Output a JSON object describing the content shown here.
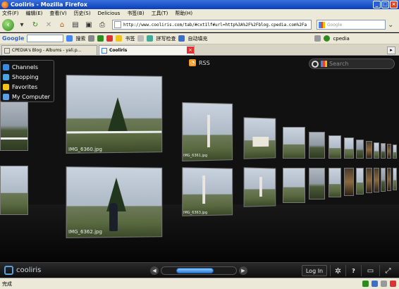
{
  "window": {
    "title": "Cooliris - Mozilla Firefox",
    "buttons": [
      "_",
      "□",
      "×"
    ]
  },
  "menu": [
    "文件(F)",
    "编辑(E)",
    "查看(V)",
    "历史(S)",
    "Delicious",
    "书签(B)",
    "工具(T)",
    "帮助(H)"
  ],
  "nav": {
    "url": "http://www.cooliris.com/tab/#cxt1lf#url=http%3A%2F%2Fblog.cpedia.com%2Fa",
    "search_placeholder": "Google"
  },
  "google_toolbar": {
    "logo": "Google",
    "search_label": "搜索",
    "bookmarks_label": "书签",
    "spellcheck_label": "拼写检查",
    "autofill_label": "自动填充",
    "user_label": "cpedia"
  },
  "tabs": [
    {
      "label": "CPEDIA's Blog - Albums - yali.p...",
      "active": false
    },
    {
      "label": "Cooliris",
      "active": true
    }
  ],
  "cooliris": {
    "rss_label": "RSS",
    "search_placeholder": "Search",
    "channels": [
      {
        "label": "Channels",
        "color": "#3a8bdc"
      },
      {
        "label": "Shopping",
        "color": "#4aa5e0"
      },
      {
        "label": "Favorites",
        "color": "#f0c419"
      },
      {
        "label": "My Computer",
        "color": "#5aa0e6"
      }
    ],
    "captions": {
      "top_main": "IMG_6360.jpg",
      "bottom_main": "IMG_6362.jpg",
      "top_second": "IMG_6361.jpg",
      "bottom_second": "IMG_6363.jpg"
    },
    "logo": "cooliris",
    "login_label": "Log In",
    "scroll_position": 0.4
  },
  "status": {
    "text": "完成"
  }
}
